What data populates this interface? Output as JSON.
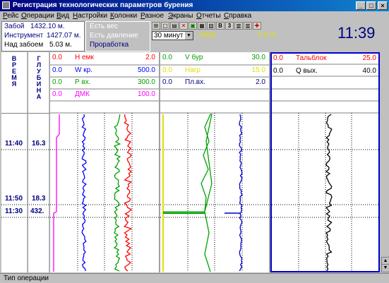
{
  "window": {
    "title": "Регистрация технологических параметров бурения",
    "controls": [
      "_",
      "□",
      "×"
    ]
  },
  "menu": [
    {
      "label": "Рейс",
      "u": "Р",
      "rest": "ейс"
    },
    {
      "label": "Операции",
      "u": "О",
      "rest": "перации"
    },
    {
      "label": "Вид",
      "u": "В",
      "rest": "ид"
    },
    {
      "label": "Настройки",
      "u": "Н",
      "rest": "астройки"
    },
    {
      "label": "Колонки",
      "u": "К",
      "rest": "олонки"
    },
    {
      "label": "Разное",
      "u": "Р",
      "rest": "азное"
    },
    {
      "label": "Экраны",
      "u": "Э",
      "rest": "краны"
    },
    {
      "label": "Отчеты",
      "u": "О",
      "rest": "тчеты"
    },
    {
      "label": "Справка",
      "u": "С",
      "rest": "правка"
    }
  ],
  "info": {
    "zaboi_label": "Забой",
    "zaboi_value": "1432.10 м.",
    "instrument_label": "Инструмент",
    "instrument_value": "1427.07 м.",
    "nad_zaboem_label": "Над забоем",
    "nad_zaboem_value": "5.03 м."
  },
  "status": {
    "line1": "Есть вес",
    "line2": "Есть давление",
    "line3": "Проработка"
  },
  "toolbar": {
    "buttons": [
      "⊞",
      "▢",
      "▤",
      "✕",
      "▣",
      "▦",
      "▧",
      "B",
      "3",
      "▥",
      "▥",
      "✚"
    ],
    "interval_value": "30 минут",
    "nagr_label": "Нагр.",
    "nagr_value": "0.0 т.",
    "clock": "11:39"
  },
  "columns": {
    "time_label": "ВРЕМЯ",
    "depth_label": "ГЛУБИНА",
    "times": [
      "11:40",
      "11:50",
      "11:30"
    ],
    "depths": [
      "16.3",
      "18.3",
      "432."
    ]
  },
  "panels": [
    {
      "params": [
        {
          "min": "0.0",
          "name": "Н емк",
          "max": "2.0",
          "color": "#ff0000"
        },
        {
          "min": "0.0",
          "name": "W кр.",
          "max": "500.0",
          "color": "#0000ff"
        },
        {
          "min": "0.0",
          "name": "Р вх.",
          "max": "300.0",
          "color": "#00a000"
        },
        {
          "min": "0.0",
          "name": "ДМК",
          "max": "100.0",
          "color": "#ff00ff"
        }
      ]
    },
    {
      "params": [
        {
          "min": "0.0",
          "name": "V бур",
          "max": "30.0",
          "color": "#00a000"
        },
        {
          "min": "0.0",
          "name": "Нагр",
          "max": "15.0",
          "color": "#e0e000"
        },
        {
          "min": "0.0",
          "name": "Пл.вх.",
          "max": "2.0",
          "color": "#000080"
        }
      ]
    },
    {
      "params": [
        {
          "min": "0.0",
          "name": "Тальблок",
          "max": "25.0",
          "color": "#ff0000"
        },
        {
          "min": "0.0",
          "name": "Q вых.",
          "max": "40.0",
          "color": "#000000"
        }
      ]
    }
  ],
  "statusbar": {
    "text": "Тип операции"
  }
}
